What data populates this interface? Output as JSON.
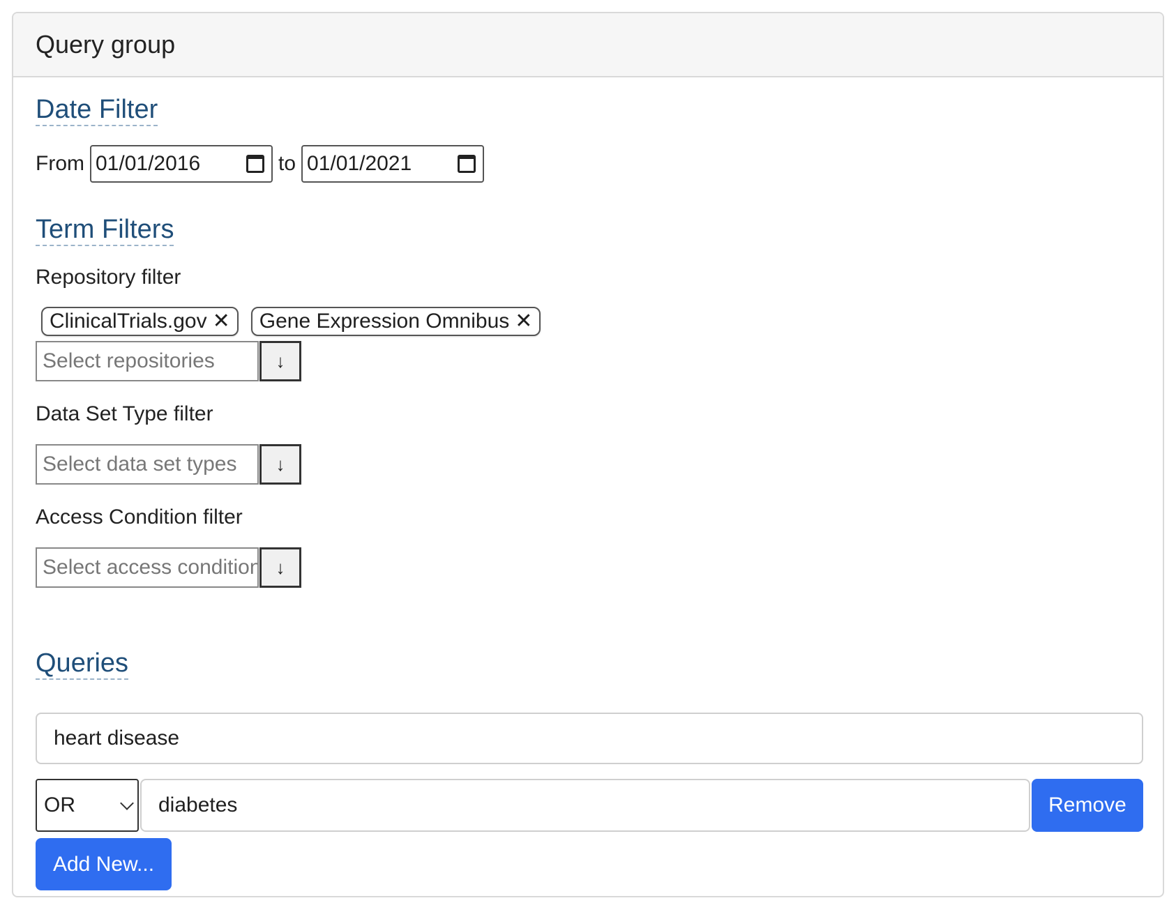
{
  "header": {
    "title": "Query group"
  },
  "date_filter": {
    "title": "Date Filter",
    "from_label": "From",
    "from_value": "01/01/2016",
    "to_label": "to",
    "to_value": "01/01/2021"
  },
  "term_filters": {
    "title": "Term Filters",
    "repository": {
      "label": "Repository filter",
      "chips": [
        {
          "label": "ClinicalTrials.gov",
          "remove": "✕"
        },
        {
          "label": "Gene Expression Omnibus",
          "remove": "✕"
        }
      ],
      "placeholder": "Select repositories",
      "toggle": "↓"
    },
    "data_set_type": {
      "label": "Data Set Type filter",
      "placeholder": "Select data set types",
      "toggle": "↓"
    },
    "access_condition": {
      "label": "Access Condition filter",
      "placeholder": "Select access conditions",
      "toggle": "↓"
    }
  },
  "queries": {
    "title": "Queries",
    "first_query": "heart disease",
    "rows": [
      {
        "operator": "OR",
        "term": "diabetes",
        "remove_label": "Remove"
      }
    ],
    "add_label": "Add New..."
  },
  "colors": {
    "accent": "#2f6df0",
    "section_title": "#1f4e79"
  },
  "icons": [
    "calendar-icon",
    "close-icon",
    "arrow-down-icon",
    "chevron-down-icon"
  ]
}
